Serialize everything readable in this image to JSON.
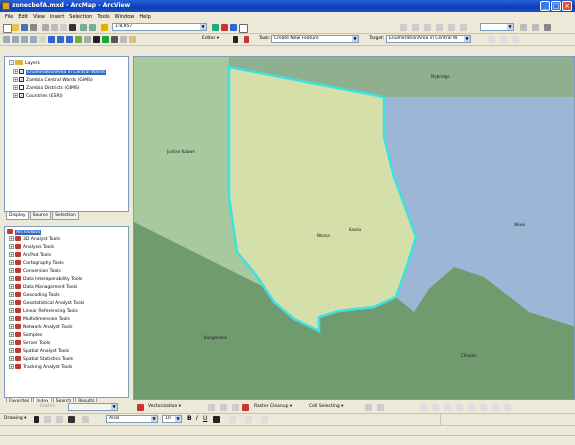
{
  "window": {
    "title": "zonecbefA.mxd - ArcMap - ArcView"
  },
  "menu": [
    "File",
    "Edit",
    "View",
    "Insert",
    "Selection",
    "Tools",
    "Window",
    "Help"
  ],
  "toolbar1": {
    "scale": "1:8,957"
  },
  "toolbar2": {
    "editor_label": "Editor ▾",
    "task_label": "Task:",
    "task_value": "Create New Feature",
    "target_label": "Target:",
    "target_value": "EnumerationArea in Central W"
  },
  "toc": {
    "root": "Layers",
    "layers": [
      {
        "label": "EnumerationArea in Central Wards",
        "checked": true,
        "selected": true
      },
      {
        "label": "Zambia Central Wards (GIMS)",
        "checked": true,
        "selected": false
      },
      {
        "label": "Zambia Districts (GIMS)",
        "checked": false,
        "selected": false
      },
      {
        "label": "Countries (ESRI)",
        "checked": true,
        "selected": false
      }
    ],
    "tabs": [
      "Display",
      "Source",
      "Selection"
    ]
  },
  "toolbox": {
    "root": "ArcToolbox",
    "items": [
      "3D Analyst Tools",
      "Analysis Tools",
      "ArcPad Tools",
      "Cartography Tools",
      "Conversion Tools",
      "Data Interoperability Tools",
      "Data Management Tools",
      "Geocoding Tools",
      "Geostatistical Analyst Tools",
      "Linear Referencing Tools",
      "Multidimension Tools",
      "Network Analyst Tools",
      "Samples",
      "Server Tools",
      "Spatial Analyst Tools",
      "Spatial Statistics Tools",
      "Tracking Analyst Tools"
    ],
    "tabs": [
      "Favorites",
      "Index",
      "Search",
      "Results"
    ]
  },
  "map": {
    "labels": [
      "Mybridge",
      "Justine Kabwe",
      "Nkana",
      "Nkwe",
      "Kangwelelo",
      "Chiwala",
      "Kaoka"
    ],
    "colors": {
      "background": "#6f9b6f",
      "poly_north": "#8fb08f",
      "poly_west": "#a8c9a0",
      "poly_east": "#9eb6d6",
      "poly_selected": "#d4dfa9",
      "highlight": "#3ee0e0"
    }
  },
  "bottom_toolbar": {
    "vectorization": "Vectorization ▾",
    "raster_cleanup": "Raster Cleanup ▾",
    "cell_selecting": "Cell Selecting ▾",
    "raster_label": "Raster:"
  },
  "draw_toolbar": {
    "drawing": "Drawing ▾",
    "font": "Arial",
    "size": "10"
  }
}
